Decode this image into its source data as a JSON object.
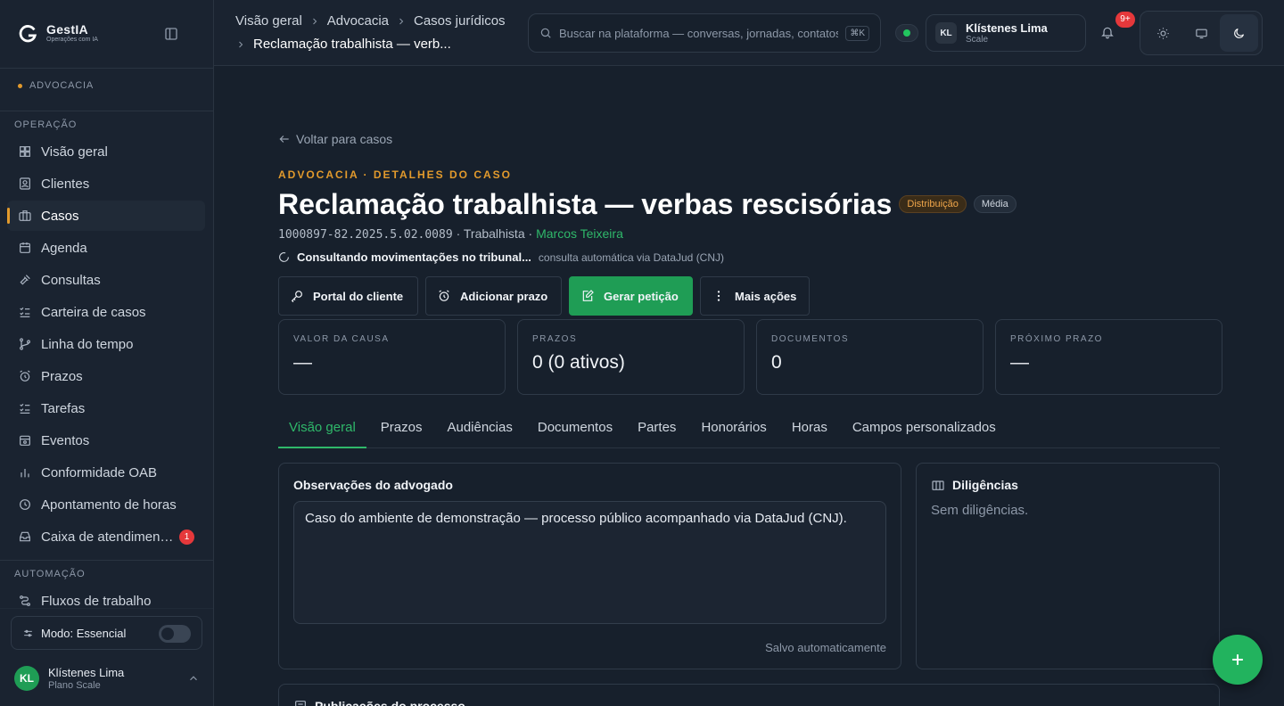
{
  "brand": {
    "name": "GestIA",
    "tagline": "Operações com IA"
  },
  "sidebar": {
    "practice_area": "ADVOCACIA",
    "section_operacao": "OPERAÇÃO",
    "section_automacao": "AUTOMAÇÃO",
    "items": [
      {
        "label": "Visão geral",
        "icon": "grid-icon"
      },
      {
        "label": "Clientes",
        "icon": "contact-icon"
      },
      {
        "label": "Casos",
        "icon": "briefcase-icon",
        "active": true
      },
      {
        "label": "Agenda",
        "icon": "calendar-icon"
      },
      {
        "label": "Consultas",
        "icon": "gavel-icon"
      },
      {
        "label": "Carteira de casos",
        "icon": "list-check-icon"
      },
      {
        "label": "Linha do tempo",
        "icon": "git-branch-icon"
      },
      {
        "label": "Prazos",
        "icon": "alarm-icon"
      },
      {
        "label": "Tarefas",
        "icon": "list-check-icon"
      },
      {
        "label": "Eventos",
        "icon": "calendar-event-icon"
      },
      {
        "label": "Conformidade OAB",
        "icon": "bar-chart-icon"
      },
      {
        "label": "Apontamento de horas",
        "icon": "clock-icon"
      },
      {
        "label": "Caixa de atendimen…",
        "icon": "inbox-icon",
        "badge": "1"
      }
    ],
    "automation_items": [
      {
        "label": "Fluxos de trabalho",
        "icon": "workflow-icon"
      }
    ],
    "mode_label": "Modo: Essencial",
    "user": {
      "initials": "KL",
      "name": "Klístenes Lima",
      "plan": "Plano Scale"
    }
  },
  "topbar": {
    "breadcrumbs": [
      "Visão geral",
      "Advocacia",
      "Casos jurídicos"
    ],
    "current": "Reclamação trabalhista — verb...",
    "search_placeholder": "Buscar na plataforma — conversas, jornadas, contatos...",
    "search_shortcut": "⌘K",
    "account": {
      "initials": "KL",
      "name": "Klístenes Lima",
      "plan": "Scale"
    },
    "notifications_badge": "9+"
  },
  "case": {
    "back_label": "Voltar para casos",
    "eyebrow": "ADVOCACIA · DETALHES DO CASO",
    "title": "Reclamação trabalhista — verbas rescisórias",
    "status_chip": "Distribuição",
    "priority_chip": "Média",
    "number": "1000897-82.2025.5.02.0089",
    "area": "Trabalhista",
    "lawyer": "Marcos Teixeira",
    "sync_text": "Consultando movimentações no tribunal...",
    "sync_source": "consulta automática via DataJud (CNJ)",
    "actions": {
      "portal": "Portal do cliente",
      "prazo": "Adicionar prazo",
      "peticao": "Gerar petição",
      "mais": "Mais ações"
    },
    "stats": [
      {
        "label": "VALOR DA CAUSA",
        "value": "—"
      },
      {
        "label": "PRAZOS",
        "value": "0 (0 ativos)"
      },
      {
        "label": "DOCUMENTOS",
        "value": "0"
      },
      {
        "label": "PRÓXIMO PRAZO",
        "value": "—"
      }
    ],
    "tabs": [
      "Visão geral",
      "Prazos",
      "Audiências",
      "Documentos",
      "Partes",
      "Honorários",
      "Horas",
      "Campos personalizados"
    ],
    "notes": {
      "title": "Observações do advogado",
      "text": "Caso do ambiente de demonstração — processo público acompanhado via DataJud (CNJ).",
      "saved": "Salvo automaticamente"
    },
    "diligencias": {
      "title": "Diligências",
      "empty": "Sem diligências."
    },
    "bottom_panel_title": "Publicações do processo"
  },
  "colors": {
    "accent_green": "#1f9d55",
    "accent_orange": "#e29a2c",
    "badge_red": "#e5383b",
    "background": "#17202c"
  }
}
